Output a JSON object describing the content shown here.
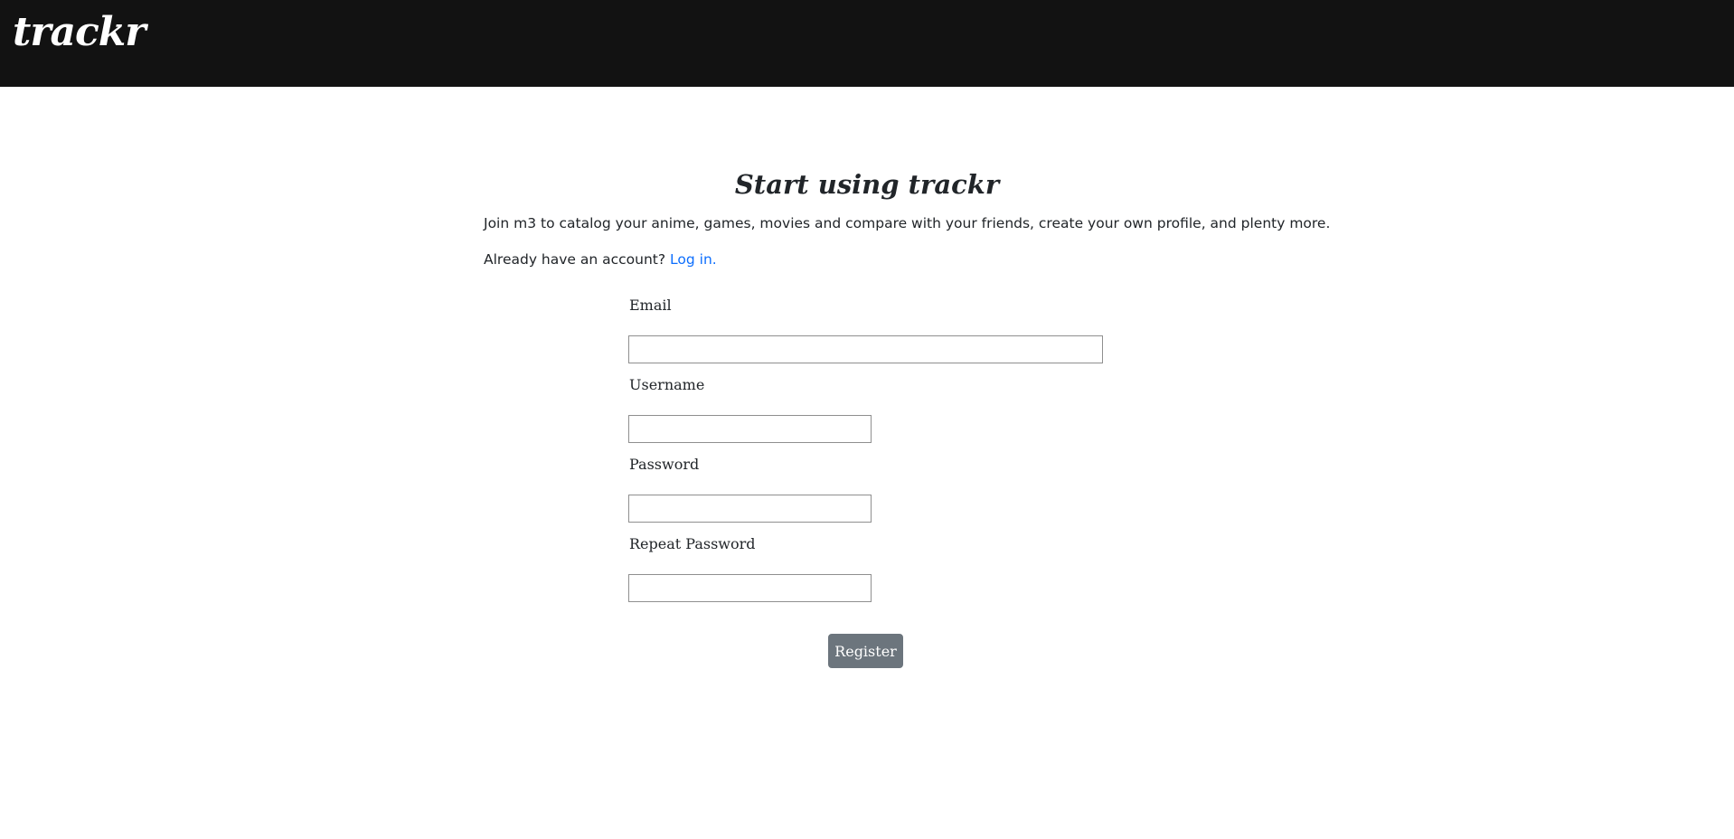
{
  "header": {
    "logo_text": "trackr",
    "background_color": "#121212"
  },
  "main": {
    "title": "Start using trackr",
    "intro": "Join m3 to catalog your anime, games, movies and compare with your friends, create your own profile, and plenty more.",
    "already_prefix": "Already have an account? ",
    "login_link": "Log in."
  },
  "form": {
    "email_label": "Email",
    "email_value": "",
    "username_label": "Username",
    "username_value": "",
    "password_label": "Password",
    "password_value": "",
    "repeat_password_label": "Repeat Password",
    "repeat_password_value": "",
    "register_label": "Register"
  },
  "colors": {
    "link": "#0d6efd",
    "button": "#6c757d",
    "text": "#212529"
  }
}
